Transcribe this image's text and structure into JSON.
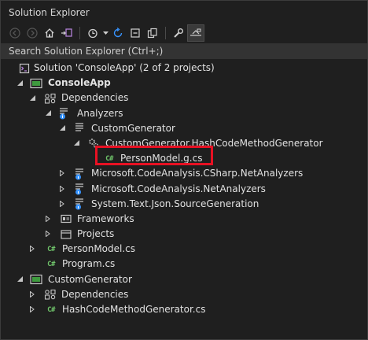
{
  "window": {
    "title": "Solution Explorer"
  },
  "toolbar": {
    "icons": [
      "back-icon",
      "forward-icon",
      "home-icon",
      "switch-views-icon",
      "pending-changes-filter-icon",
      "sync-icon",
      "collapse-all-icon",
      "show-all-files-icon",
      "properties-icon",
      "preview-selected-icon"
    ]
  },
  "search": {
    "placeholder": "Search Solution Explorer (Ctrl+;)"
  },
  "tree": {
    "solution": "Solution 'ConsoleApp' (2 of 2 projects)",
    "console_app": "ConsoleApp",
    "dependencies": "Dependencies",
    "analyzers": "Analyzers",
    "custom_generator_analyzer": "CustomGenerator",
    "hash_generator": "CustomGenerator.HashCodeMethodGenerator",
    "person_model_g": "PersonModel.g.cs",
    "csharp_analyzers": "Microsoft.CodeAnalysis.CSharp.NetAnalyzers",
    "net_analyzers": "Microsoft.CodeAnalysis.NetAnalyzers",
    "json_source_gen": "System.Text.Json.SourceGeneration",
    "frameworks": "Frameworks",
    "projects": "Projects",
    "person_model": "PersonModel.cs",
    "program": "Program.cs",
    "custom_generator_project": "CustomGenerator",
    "dependencies_2": "Dependencies",
    "hash_generator_file": "HashCodeMethodGenerator.cs"
  },
  "cs_badge": "C#",
  "colors": {
    "highlight": "#e81123",
    "background": "#1f1f1f",
    "csharp": "#6fc36a",
    "project": "#3e9a3e"
  }
}
